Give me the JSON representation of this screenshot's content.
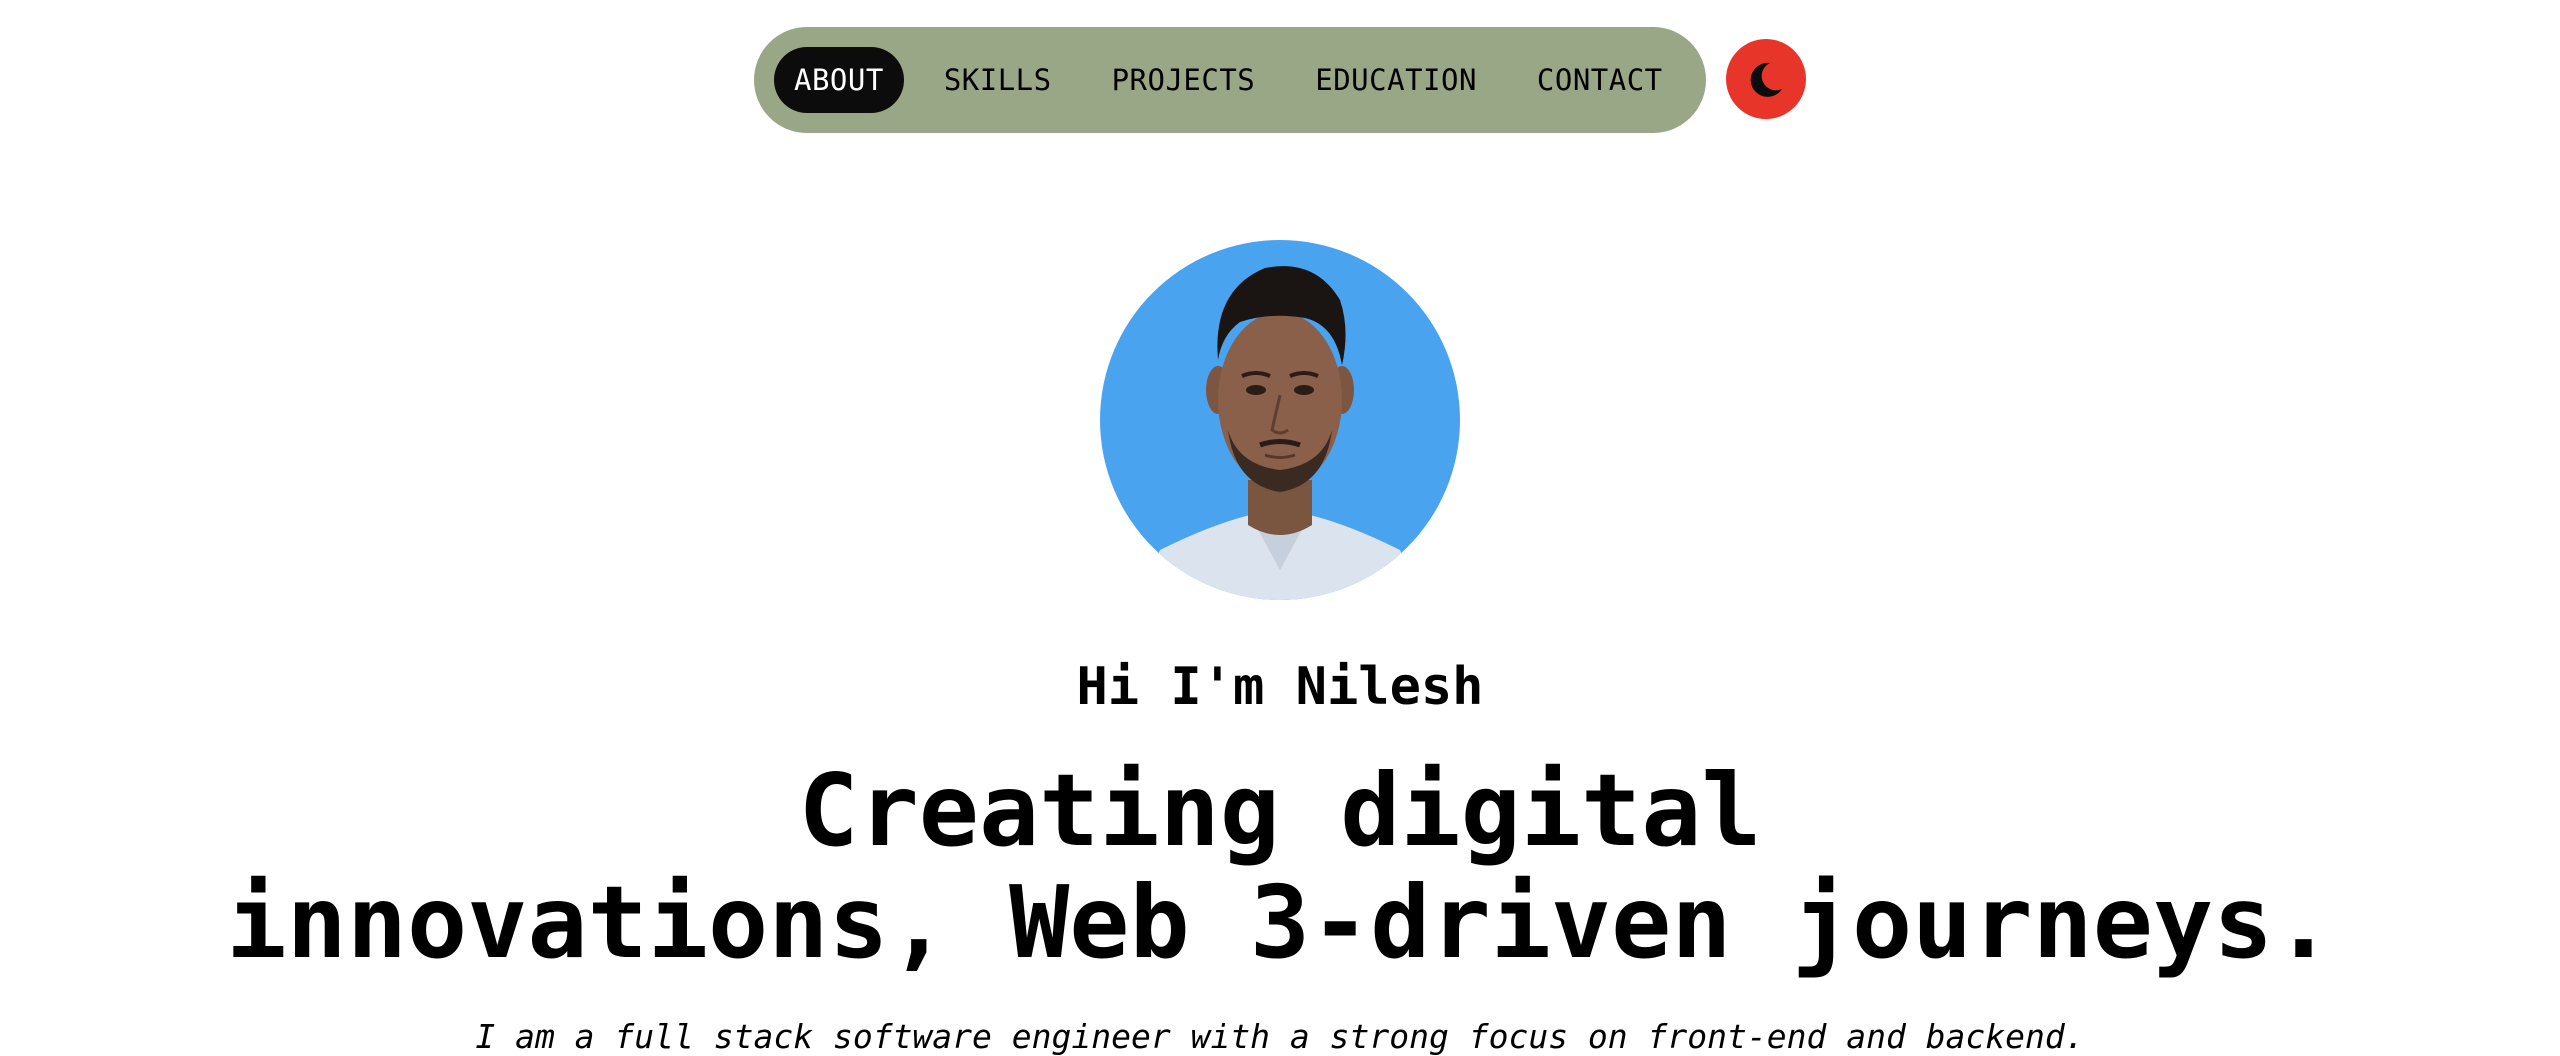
{
  "nav": {
    "items": [
      {
        "label": "ABOUT",
        "active": true
      },
      {
        "label": "SKILLS",
        "active": false
      },
      {
        "label": "PROJECTS",
        "active": false
      },
      {
        "label": "EDUCATION",
        "active": false
      },
      {
        "label": "CONTACT",
        "active": false
      }
    ]
  },
  "theme_toggle": {
    "icon": "moon-icon"
  },
  "hero": {
    "avatar_icon": "profile-photo",
    "greeting": "Hi I'm Nilesh",
    "headline_line1": "Creating digital",
    "headline_line2": "innovations, Web 3-driven journeys.",
    "tagline": "I am a full stack software engineer with a strong focus on front-end and backend."
  },
  "colors": {
    "nav_pill": "#9aa787",
    "nav_active_bg": "#0c0c0c",
    "toggle_bg": "#e8352a",
    "avatar_bg": "#4aa3ee",
    "text": "#000000",
    "background": "#ffffff"
  }
}
